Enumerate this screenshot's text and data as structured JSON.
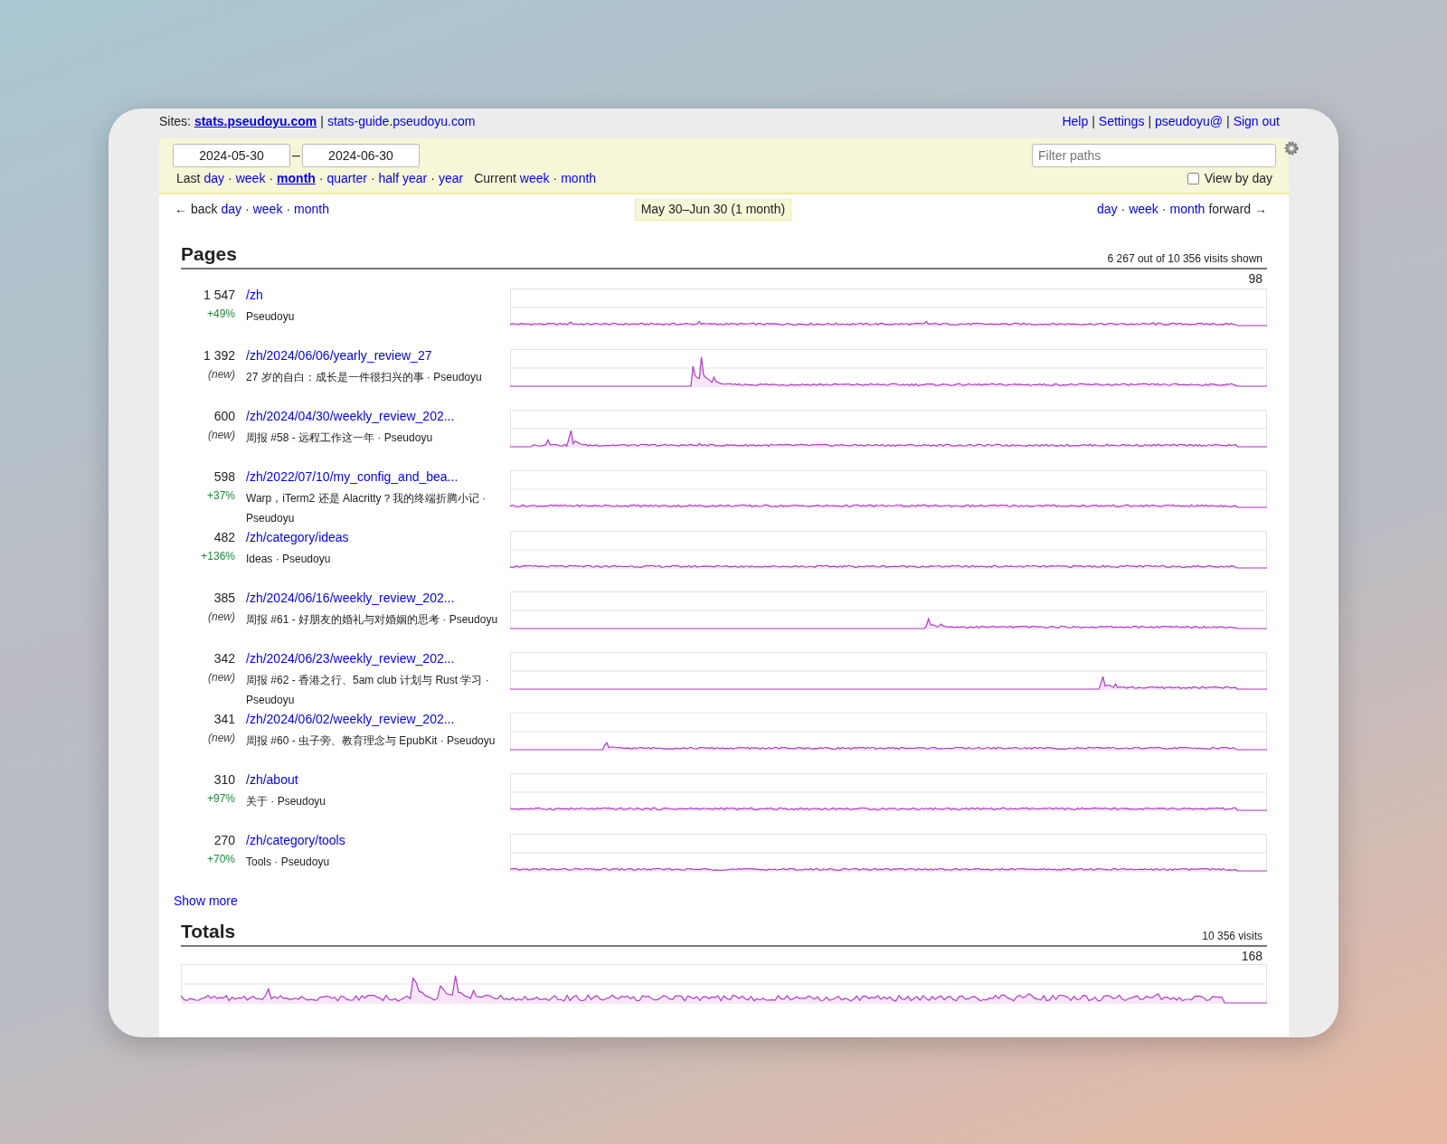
{
  "header": {
    "sites_label": "Sites:",
    "sites": [
      {
        "label": "stats.pseudoyu.com",
        "selected": true
      },
      {
        "label": "stats-guide.pseudoyu.com",
        "selected": false
      }
    ],
    "links": [
      "Help",
      "Settings",
      "pseudoyu@",
      "Sign out"
    ],
    "separator": "|"
  },
  "toolbar": {
    "date_from": "2024-05-30",
    "date_sep": "–",
    "date_to": "2024-06-30",
    "last_label": "Last",
    "last_links": [
      {
        "label": "day",
        "selected": false
      },
      {
        "label": "week",
        "selected": false
      },
      {
        "label": "month",
        "selected": true
      },
      {
        "label": "quarter",
        "selected": false
      },
      {
        "label": "half year",
        "selected": false
      },
      {
        "label": "year",
        "selected": false
      }
    ],
    "current_label": "Current",
    "current_links": [
      "week",
      "month"
    ],
    "link_separator": "·",
    "filter": {
      "placeholder": "Filter paths"
    },
    "view_by_day": {
      "label": "View by day",
      "checked": false
    }
  },
  "nav": {
    "back_label": "← back",
    "back_links": [
      "day",
      "week",
      "month"
    ],
    "period": "May 30–Jun 30 (1 month)",
    "forward_links": [
      "day",
      "week",
      "month"
    ],
    "forward_label": "forward →",
    "link_separator": "·"
  },
  "pages": {
    "title": "Pages",
    "summary": "6 267 out of 10 356 visits shown",
    "scale_label": "98",
    "rows": [
      {
        "count": "1 547",
        "change": "+49%",
        "kind": "growth",
        "path": "/zh",
        "title": "Pseudoyu"
      },
      {
        "count": "1 392",
        "change": "(new)",
        "kind": "new",
        "path": "/zh/2024/06/06/yearly_review_27",
        "title": "27 岁的自白：成长是一件很扫兴的事 · Pseudoyu"
      },
      {
        "count": "600",
        "change": "(new)",
        "kind": "new",
        "path": "/zh/2024/04/30/weekly_review_202...",
        "title": "周报 #58 - 远程工作这一年 · Pseudoyu"
      },
      {
        "count": "598",
        "change": "+37%",
        "kind": "growth",
        "path": "/zh/2022/07/10/my_config_and_bea...",
        "title": "Warp，iTerm2 还是 Alacritty？我的终端折腾小记 · Pseudoyu"
      },
      {
        "count": "482",
        "change": "+136%",
        "kind": "growth",
        "path": "/zh/category/ideas",
        "title": "Ideas · Pseudoyu"
      },
      {
        "count": "385",
        "change": "(new)",
        "kind": "new",
        "path": "/zh/2024/06/16/weekly_review_202...",
        "title": "周报 #61 - 好朋友的婚礼与对婚姻的思考 · Pseudoyu"
      },
      {
        "count": "342",
        "change": "(new)",
        "kind": "new",
        "path": "/zh/2024/06/23/weekly_review_202...",
        "title": "周报 #62 - 香港之行、5am club 计划与 Rust 学习 · Pseudoyu"
      },
      {
        "count": "341",
        "change": "(new)",
        "kind": "new",
        "path": "/zh/2024/06/02/weekly_review_202...",
        "title": "周报 #60 - 虫子旁、教育理念与 EpubKit · Pseudoyu"
      },
      {
        "count": "310",
        "change": "+97%",
        "kind": "growth",
        "path": "/zh/about",
        "title": "关于 · Pseudoyu"
      },
      {
        "count": "270",
        "change": "+70%",
        "kind": "growth",
        "path": "/zh/category/tools",
        "title": "Tools · Pseudoyu"
      }
    ],
    "show_more": "Show more"
  },
  "totals": {
    "title": "Totals",
    "summary": "10 356 visits",
    "scale_label": "168"
  }
}
